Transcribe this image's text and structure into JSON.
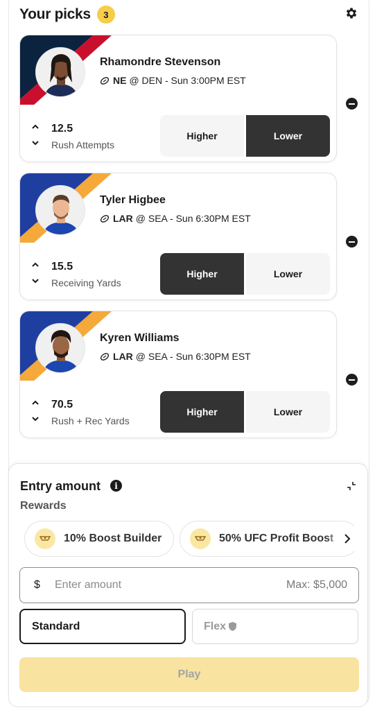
{
  "header": {
    "title": "Your picks",
    "count": "3"
  },
  "picks": [
    {
      "player_name": "Rhamondre Stevenson",
      "team": "NE",
      "matchup_rest": "@ DEN - Sun 3:00PM EST",
      "line": "12.5",
      "stat": "Rush Attempts",
      "higher_label": "Higher",
      "lower_label": "Lower",
      "selected": "Lower",
      "colors": {
        "primary": "#0c2340",
        "stripe": "#c8102e"
      }
    },
    {
      "player_name": "Tyler Higbee",
      "team": "LAR",
      "matchup_rest": "@ SEA - Sun 6:30PM EST",
      "line": "15.5",
      "stat": "Receiving Yards",
      "higher_label": "Higher",
      "lower_label": "Lower",
      "selected": "Higher",
      "colors": {
        "primary": "#1f3fa0",
        "stripe": "#f4a93a"
      }
    },
    {
      "player_name": "Kyren Williams",
      "team": "LAR",
      "matchup_rest": "@ SEA - Sun 6:30PM EST",
      "line": "70.5",
      "stat": "Rush + Rec Yards",
      "higher_label": "Higher",
      "lower_label": "Lower",
      "selected": "Higher",
      "colors": {
        "primary": "#1f3fa0",
        "stripe": "#f4a93a"
      }
    }
  ],
  "entry": {
    "title": "Entry amount",
    "info_glyph": "i",
    "rewards_label": "Rewards",
    "rewards": [
      {
        "label": "10% Boost Builder"
      },
      {
        "label": "50% UFC Profit Boost"
      }
    ],
    "currency_symbol": "$",
    "amount_value": "",
    "amount_placeholder": "Enter amount",
    "max_label": "Max: $5,000",
    "mode_standard": "Standard",
    "mode_flex": "Flex",
    "selected_mode": "Standard",
    "play_label": "Play"
  },
  "theme": {
    "badge": "#f5cd47",
    "selected_choice": "#333333",
    "play_disabled": "#f8e3a0",
    "coin": "#fbe7a4"
  },
  "icons": [
    "gear-icon",
    "football-icon",
    "chevron-up-icon",
    "chevron-down-icon",
    "remove-icon",
    "info-icon",
    "collapse-icon",
    "reward-coin-icon",
    "chevron-right-icon",
    "shield-icon"
  ]
}
